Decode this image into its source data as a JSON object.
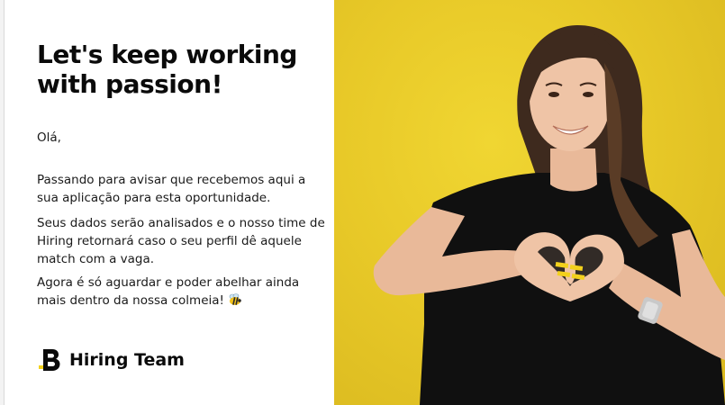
{
  "headline": "Let's keep working with passion!",
  "greeting": "Olá,",
  "paragraphs": [
    "Passando para avisar que recebemos aqui a sua aplicação para esta oportunidade.",
    "Seus dados serão analisados e o nosso time de Hiring retornará caso o seu perfil dê aquele match com a vaga.",
    "Agora é só aguardar e poder abelhar ainda mais dentro da nossa colmeia!"
  ],
  "signature": {
    "logo_icon": "brand-logo-icon",
    "name": "Hiring Team"
  },
  "colors": {
    "brand_yellow": "#ECCE2A",
    "text_dark": "#0A0A0A"
  },
  "emoji_icon": "bee-icon"
}
